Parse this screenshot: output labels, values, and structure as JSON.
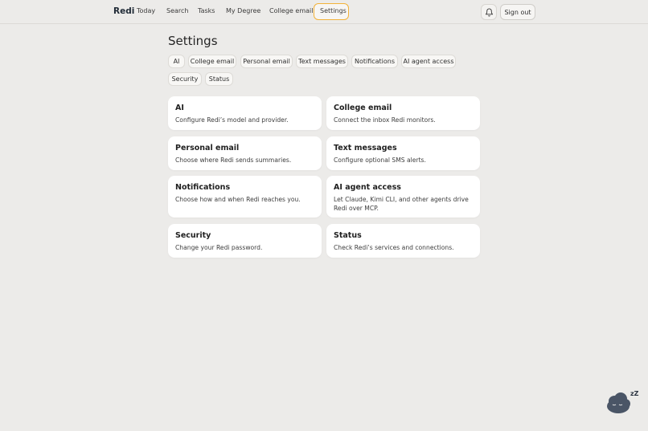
{
  "nav": {
    "brand": "Redi",
    "links": [
      "Today",
      "Search",
      "Tasks",
      "My Degree",
      "College email",
      "Settings"
    ],
    "active": "Settings",
    "sign_out": "Sign out",
    "bell_icon": "bell-icon"
  },
  "page": {
    "title": "Settings"
  },
  "tabs": [
    "AI",
    "College email",
    "Personal email",
    "Text messages",
    "Notifications",
    "AI agent access",
    "Security",
    "Status"
  ],
  "cards": [
    {
      "title": "AI",
      "desc": "Configure Redi’s model and provider."
    },
    {
      "title": "College email",
      "desc": "Connect the inbox Redi monitors."
    },
    {
      "title": "Personal email",
      "desc": "Choose where Redi sends summaries."
    },
    {
      "title": "Text messages",
      "desc": "Configure optional SMS alerts."
    },
    {
      "title": "Notifications",
      "desc": "Choose how and when Redi reaches you."
    },
    {
      "title": "AI agent access",
      "desc": "Let Claude, Kimi CLI, and other agents drive Redi over MCP."
    },
    {
      "title": "Security",
      "desc": "Change your Redi password."
    },
    {
      "title": "Status",
      "desc": "Check Redi’s services and connections."
    }
  ],
  "mascot": {
    "label": "zZ",
    "icon": "sleeping-cloud-icon"
  },
  "colors": {
    "active_outline": "#f2b23a",
    "background": "#ecebe9",
    "card": "#ffffff"
  }
}
